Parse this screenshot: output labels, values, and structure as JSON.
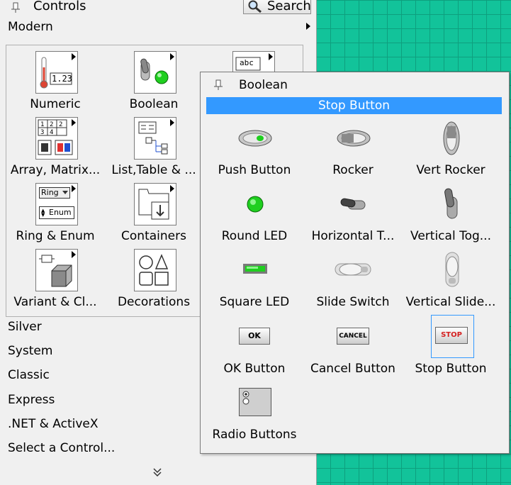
{
  "palette": {
    "title": "Controls",
    "search_label": "Search",
    "active_category": "Modern",
    "tiles": [
      {
        "label": "Numeric"
      },
      {
        "label": "Boolean"
      },
      {
        "label": "Array, Matrix..."
      },
      {
        "label": "List,Table & ..."
      },
      {
        "label": "Ring & Enum"
      },
      {
        "label": "Containers"
      },
      {
        "label": "Variant & Cl..."
      },
      {
        "label": "Decorations"
      }
    ],
    "tile_glyphs": {
      "numeric": "1.23",
      "abc": "abc",
      "ring": "Ring",
      "enum": "Enum"
    },
    "categories": [
      "Silver",
      "System",
      "Classic",
      "Express",
      ".NET & ActiveX",
      "Select a Control..."
    ]
  },
  "boolean_popup": {
    "title": "Boolean",
    "hover_tooltip": "Stop Button",
    "controls": [
      {
        "label": "Push Button"
      },
      {
        "label": "Rocker"
      },
      {
        "label": "Vert Rocker"
      },
      {
        "label": "Round LED"
      },
      {
        "label": "Horizontal T..."
      },
      {
        "label": "Vertical Tog..."
      },
      {
        "label": "Square LED"
      },
      {
        "label": "Slide Switch"
      },
      {
        "label": "Vertical Slide..."
      },
      {
        "label": "OK Button"
      },
      {
        "label": "Cancel Button"
      },
      {
        "label": "Stop Button"
      },
      {
        "label": "Radio Buttons"
      }
    ],
    "button_glyphs": {
      "ok": "OK",
      "cancel": "CANCEL",
      "stop": "STOP"
    },
    "selected": "Stop Button"
  },
  "colors": {
    "selection": "#3399ff",
    "led_green": "#1fcf1f",
    "canvas_grid": "#12c39a"
  }
}
